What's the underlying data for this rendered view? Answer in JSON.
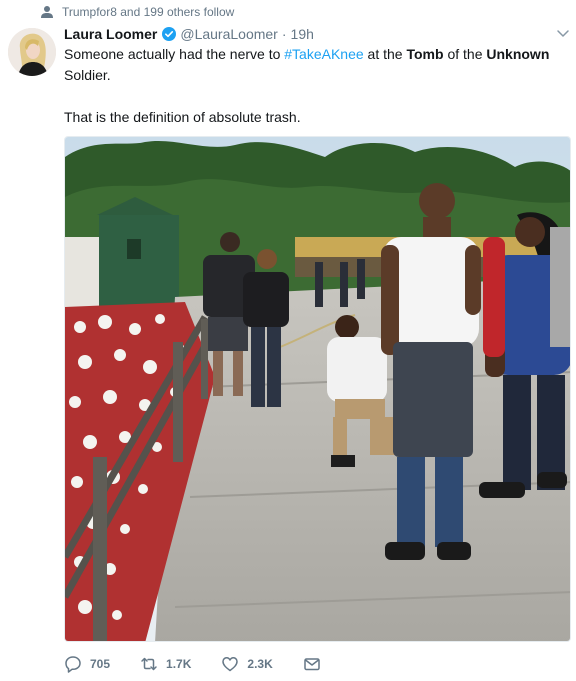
{
  "social_context": {
    "text": "Trumpfor8 and 199 others follow",
    "icon": "person-icon"
  },
  "tweet": {
    "author_name": "Laura Loomer",
    "handle": "@LauraLoomer",
    "separator": "·",
    "time": "19h",
    "text_part1": "Someone actually had the nerve to ",
    "hashtag": "#TakeAKnee",
    "text_part2": " at the ",
    "bold1": "Tomb",
    "text_part3": " of the ",
    "bold2": "Unknown",
    "text_part4": " Soldier.",
    "text_line2": "That is the definition of absolute trash."
  },
  "actions": {
    "reply_count": "705",
    "retweet_count": "1.7K",
    "like_count": "2.3K"
  },
  "colors": {
    "link": "#1da1f2",
    "secondary": "#657786",
    "verified": "#1da1f2"
  }
}
